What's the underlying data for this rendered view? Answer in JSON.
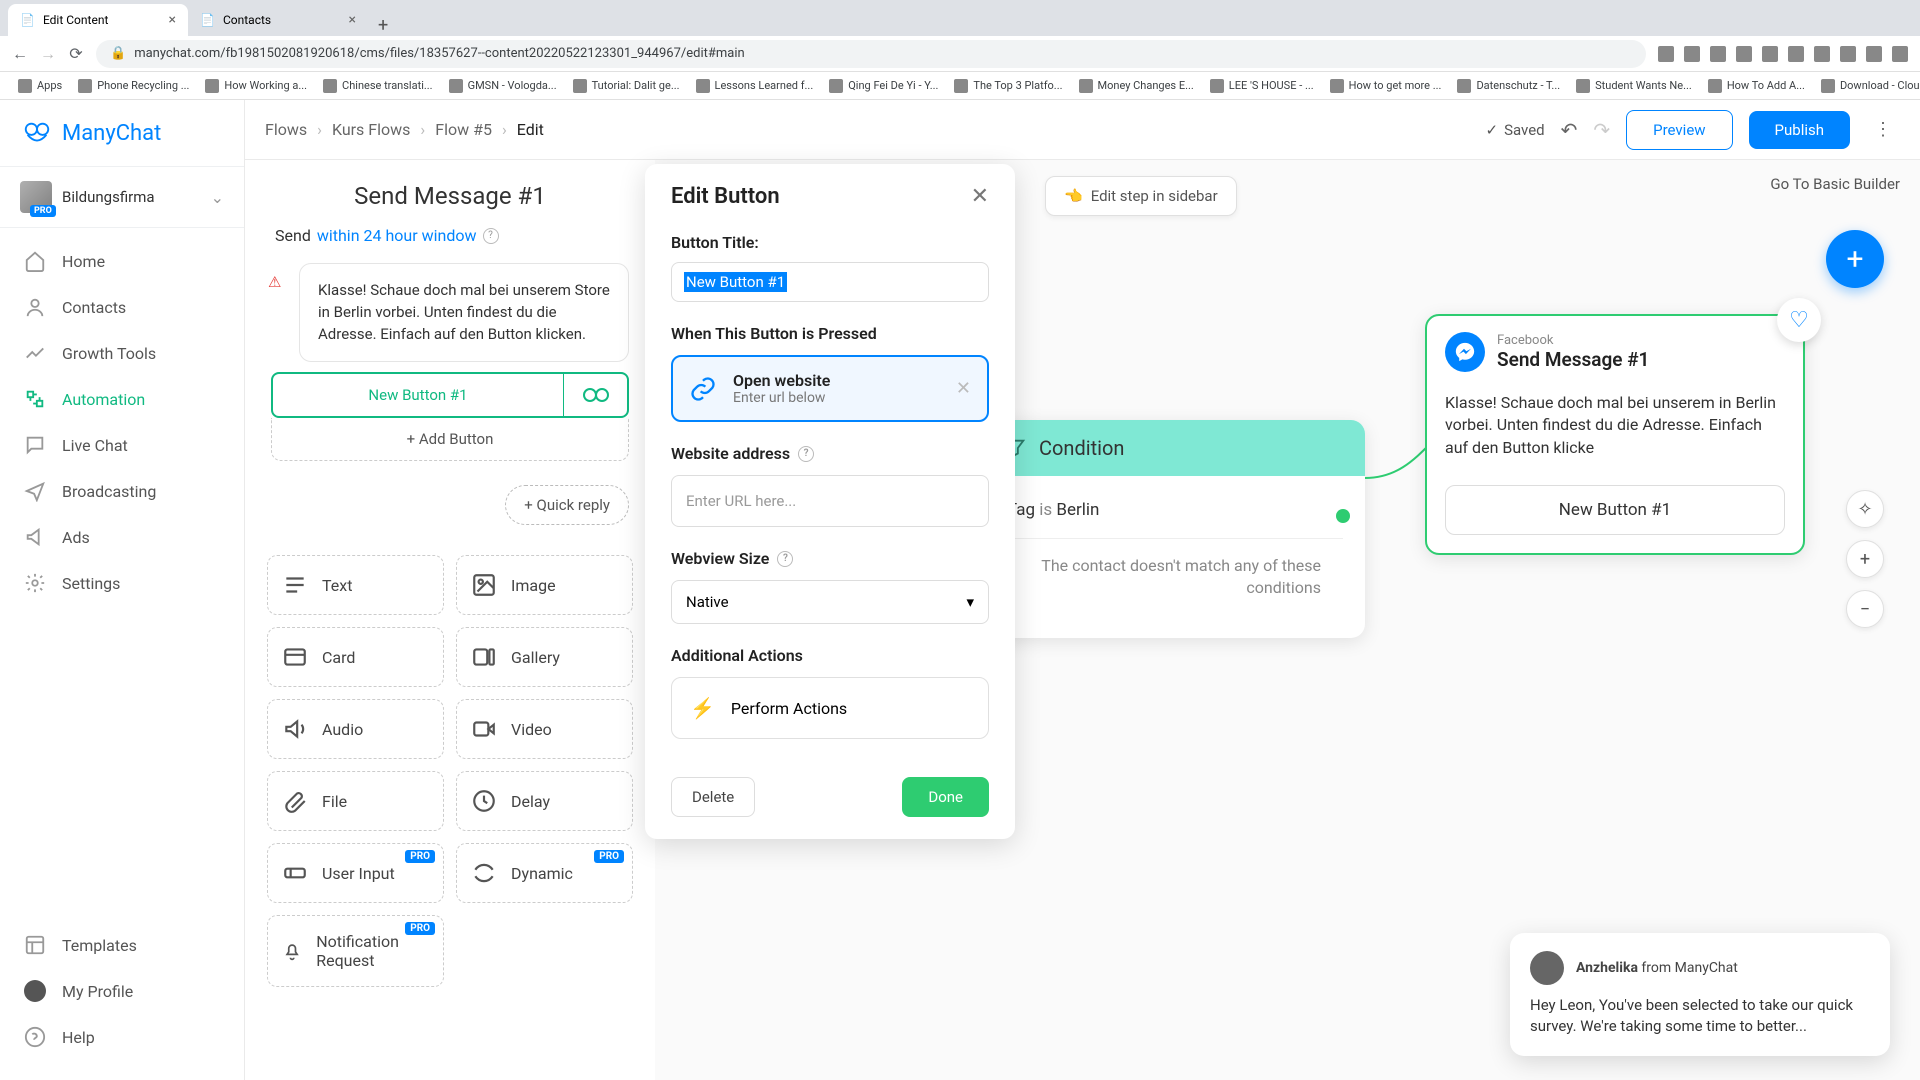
{
  "browser": {
    "tabs": [
      {
        "title": "Edit Content",
        "active": true
      },
      {
        "title": "Contacts",
        "active": false
      }
    ],
    "url": "manychat.com/fb1981502081920618/cms/files/18357627--content20220522123301_944967/edit#main",
    "bookmarks": [
      "Apps",
      "Phone Recycling ...",
      "How Working a...",
      "Chinese translati...",
      "GMSN - Vologda...",
      "Tutorial: Dalit ge...",
      "Lessons Learned f...",
      "Qing Fei De Yi - Y...",
      "The Top 3 Platfo...",
      "Money Changes E...",
      "LEE 'S HOUSE - ...",
      "How to get more ...",
      "Datenschutz - T...",
      "Student Wants Ne...",
      "How To Add A...",
      "Download - Clou..."
    ]
  },
  "app": {
    "brand": "ManyChat",
    "org": "Bildungsfirma",
    "pro": "PRO",
    "nav": [
      "Home",
      "Contacts",
      "Growth Tools",
      "Automation",
      "Live Chat",
      "Broadcasting",
      "Ads",
      "Settings"
    ],
    "navActive": 3,
    "navBottom": [
      "Templates",
      "My Profile",
      "Help"
    ]
  },
  "topbar": {
    "breadcrumbs": [
      "Flows",
      "Kurs Flows",
      "Flow #5",
      "Edit"
    ],
    "saved": "Saved",
    "preview": "Preview",
    "publish": "Publish",
    "editSidebar": "Edit step in sidebar",
    "basicBuilder": "Go To Basic Builder"
  },
  "editor": {
    "title": "Send Message #1",
    "sendPrefix": "Send",
    "sendLink": "within 24 hour window",
    "messageText": "Klasse! Schaue doch mal bei unserem Store in Berlin vorbei. Unten findest du die Adresse. Einfach auf den Button klicken.",
    "buttonLabel": "New Button #1",
    "addButton": "+ Add Button",
    "quickReply": "+ Quick reply",
    "blocks": [
      "Text",
      "Image",
      "Card",
      "Gallery",
      "Audio",
      "Video",
      "File",
      "Delay",
      "User Input",
      "Dynamic",
      "Notification Request"
    ],
    "proBlocks": [
      8,
      9,
      10
    ]
  },
  "modal": {
    "title": "Edit Button",
    "buttonTitleLabel": "Button Title:",
    "buttonTitleValue": "New Button #1",
    "whenPressed": "When This Button is Pressed",
    "openWebsite": "Open website",
    "openWebsiteSub": "Enter url below",
    "websiteAddress": "Website address",
    "urlPlaceholder": "Enter URL here...",
    "webviewSize": "Webview Size",
    "webviewValue": "Native",
    "additionalActions": "Additional Actions",
    "performActions": "Perform Actions",
    "delete": "Delete",
    "done": "Done"
  },
  "condition": {
    "title": "Condition",
    "tagPrefix": "Tag",
    "tagIs": "is",
    "tagValue": "Berlin",
    "noMatch": "The contact doesn't match any of these conditions"
  },
  "msgNode": {
    "platform": "Facebook",
    "title": "Send Message #1",
    "body": "Klasse! Schaue doch mal bei unserem in Berlin vorbei. Unten findest du die Adresse. Einfach auf den Button klicke",
    "button": "New Button #1"
  },
  "widget": {
    "name": "Anzhelika",
    "from": "from ManyChat",
    "body": "Hey Leon,  You've been selected to take our quick survey. We're taking some time to better..."
  }
}
